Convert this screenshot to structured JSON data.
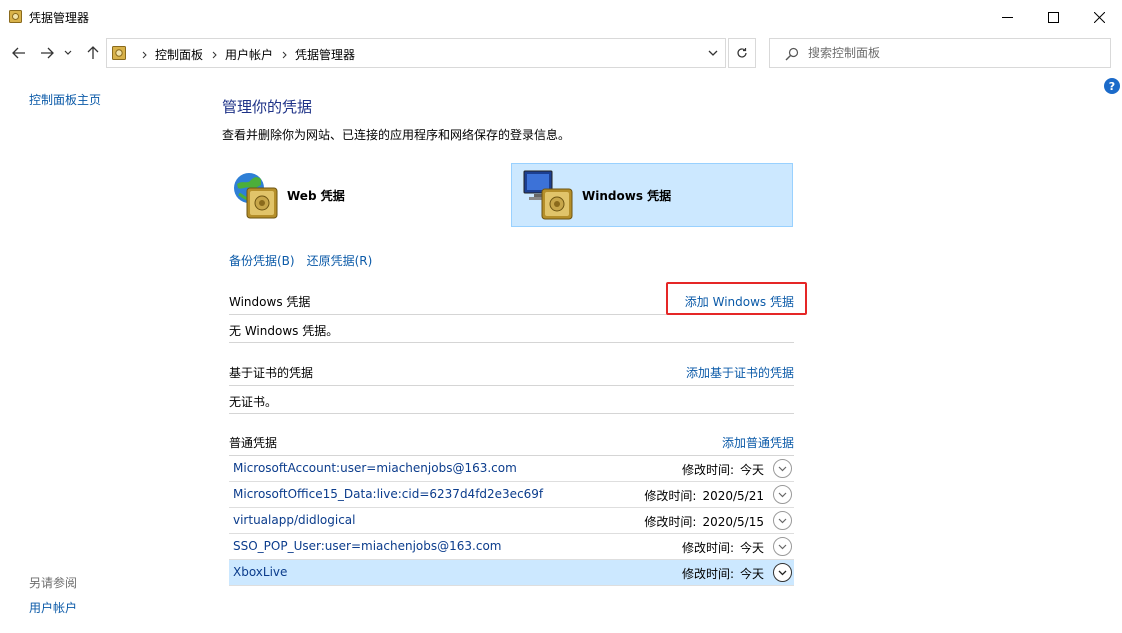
{
  "window": {
    "title": "凭据管理器"
  },
  "address": {
    "crumbs": [
      "控制面板",
      "用户帐户",
      "凭据管理器"
    ]
  },
  "search": {
    "placeholder": "搜索控制面板"
  },
  "help": "?",
  "left": {
    "home_link": "控制面板主页",
    "see_also": "另请参阅",
    "user_accounts": "用户帐户"
  },
  "main": {
    "heading": "管理你的凭据",
    "subtext": "查看并删除你为网站、已连接的应用程序和网络保存的登录信息。",
    "tiles": {
      "web": "Web 凭据",
      "windows": "Windows 凭据"
    },
    "backup": "备份凭据(B)",
    "restore": "还原凭据(R)",
    "sections": {
      "windows": {
        "title": "Windows 凭据",
        "add": "添加 Windows 凭据",
        "empty": "无 Windows 凭据。"
      },
      "cert": {
        "title": "基于证书的凭据",
        "add": "添加基于证书的凭据",
        "empty": "无证书。"
      },
      "generic": {
        "title": "普通凭据",
        "add": "添加普通凭据"
      }
    },
    "modified_label": "修改时间:",
    "generic_items": [
      {
        "name": "MicrosoftAccount:user=miachenjobs@163.com",
        "modified": "今天"
      },
      {
        "name": "MicrosoftOffice15_Data:live:cid=6237d4fd2e3ec69f",
        "modified": "2020/5/21"
      },
      {
        "name": "virtualapp/didlogical",
        "modified": "2020/5/15"
      },
      {
        "name": "SSO_POP_User:user=miachenjobs@163.com",
        "modified": "今天"
      },
      {
        "name": "XboxLive",
        "modified": "今天"
      }
    ]
  },
  "colors": {
    "accent": "#0b5aa8",
    "heading": "#1e3287",
    "selected_bg": "#cce8ff",
    "highlight": "#e52626"
  }
}
